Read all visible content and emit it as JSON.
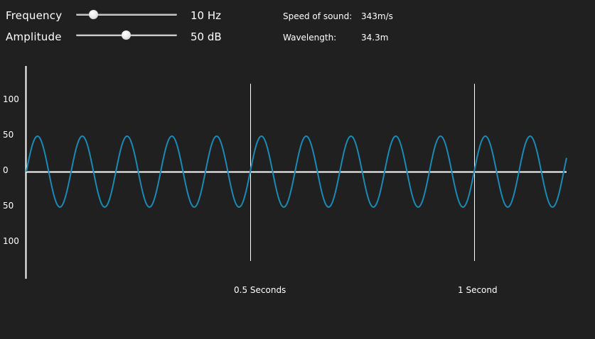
{
  "controls": {
    "frequency": {
      "label": "Frequency",
      "value_text": "10 Hz",
      "slider_fraction": 0.14
    },
    "amplitude": {
      "label": "Amplitude",
      "value_text": "50 dB",
      "slider_fraction": 0.5
    }
  },
  "info": {
    "speed_label": "Speed of sound:",
    "speed_value": "343m/s",
    "wavelength_label": "Wavelength:",
    "wavelength_value": "34.3m"
  },
  "colors": {
    "background": "#202020",
    "wave": "#1a8ab5",
    "axis": "#ffffff"
  },
  "chart_data": {
    "type": "line",
    "y_tick_labels": [
      "100",
      "50",
      "0",
      "50",
      "100"
    ],
    "y_tick_values": [
      100,
      50,
      0,
      -50,
      -100
    ],
    "ylim": [
      -150,
      150
    ],
    "xlim": [
      0,
      1.2
    ],
    "markers": [
      {
        "x": 0.5,
        "label": "0.5 Seconds"
      },
      {
        "x": 1.0,
        "label": "1 Second"
      }
    ],
    "series": [
      {
        "frequency_hz": 10,
        "amplitude": 50,
        "wave": "sine",
        "starting_phase": "rising from 0"
      }
    ]
  }
}
